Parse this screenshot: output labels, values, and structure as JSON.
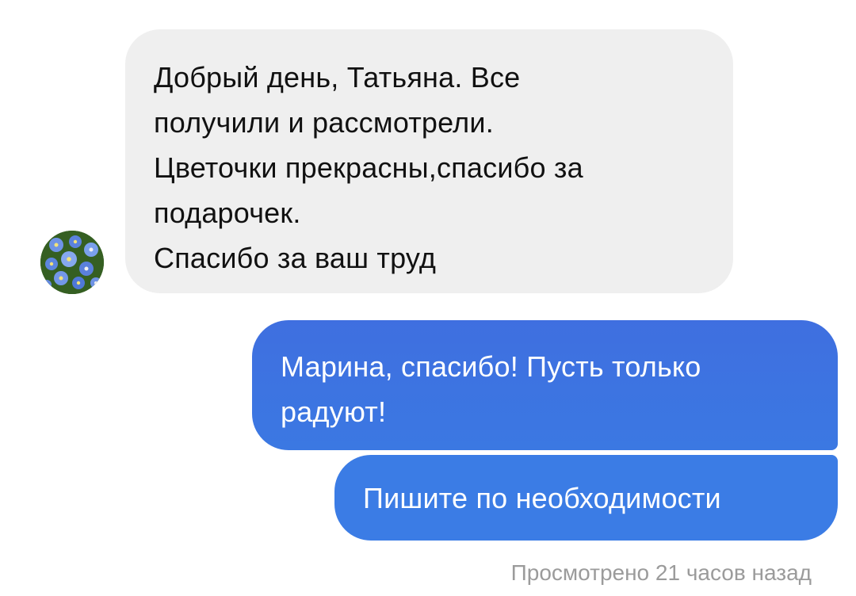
{
  "incoming": {
    "lines": [
      "Добрый день, Татьяна. Все",
      "получили и рассмотрели.",
      "Цветочки прекрасны,спасибо за",
      "подарочек.",
      "Спасибо за ваш труд"
    ],
    "avatar_icon": "forget-me-not-flowers-avatar"
  },
  "outgoing": [
    {
      "lines": [
        "Марина, спасибо! Пусть только",
        "радуют!"
      ]
    },
    {
      "lines": [
        "Пишите по необходимости"
      ]
    }
  ],
  "seen_status": "Просмотрено 21 часов назад",
  "colors": {
    "incoming_bubble": "#efefef",
    "outgoing_bubble": "#3d7be0",
    "status_text": "#9b9b9b"
  }
}
